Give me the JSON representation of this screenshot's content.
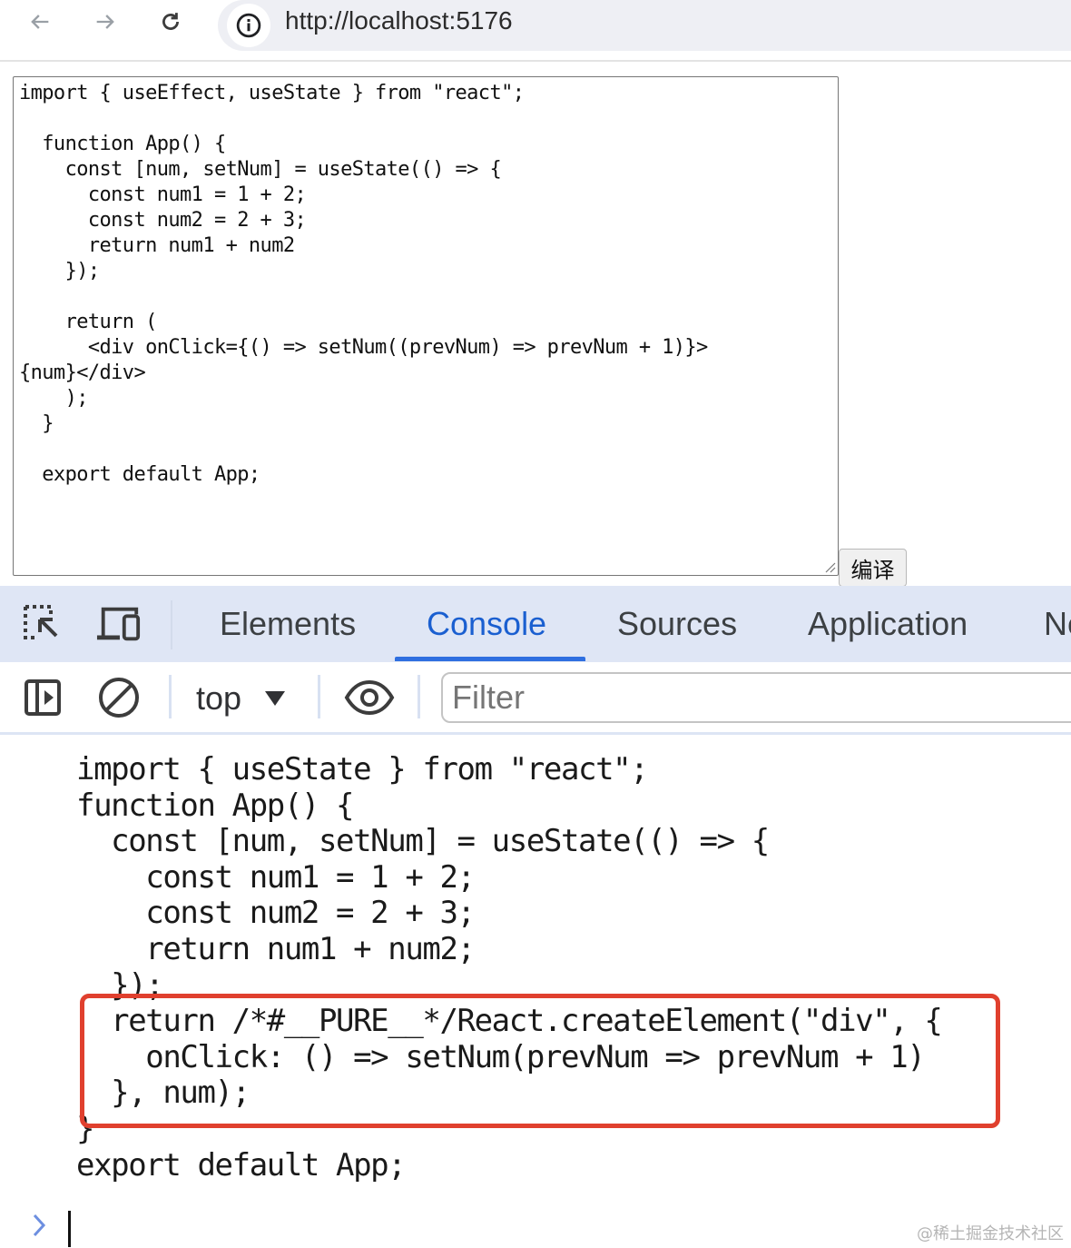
{
  "browser": {
    "url": "http://localhost:5176",
    "icons": [
      "back-arrow-icon",
      "forward-arrow-icon",
      "reload-icon",
      "info-icon"
    ]
  },
  "editor": {
    "code": "import { useEffect, useState } from \"react\";\n\n  function App() {\n    const [num, setNum] = useState(() => {\n      const num1 = 1 + 2;\n      const num2 = 2 + 3;\n      return num1 + num2\n    });\n\n    return (\n      <div onClick={() => setNum((prevNum) => prevNum + 1)}>\n{num}</div>\n    );\n  }\n\n  export default App;",
    "compile_button_label": "编译"
  },
  "devtools": {
    "tabs": [
      {
        "label": "Elements",
        "active": false
      },
      {
        "label": "Console",
        "active": true
      },
      {
        "label": "Sources",
        "active": false
      },
      {
        "label": "Application",
        "active": false
      },
      {
        "label": "Ne",
        "active": false
      }
    ],
    "icons": [
      "inspect-element-icon",
      "device-toolbar-icon"
    ],
    "accent_color": "#1a5fd0"
  },
  "console_toolbar": {
    "context": "top",
    "filter_placeholder": "Filter",
    "icons": [
      "sidebar-toggle-icon",
      "clear-console-icon",
      "live-expression-eye-icon"
    ]
  },
  "console": {
    "output": "import { useState } from \"react\";\nfunction App() {\n  const [num, setNum] = useState(() => {\n    const num1 = 1 + 2;\n    const num2 = 2 + 3;\n    return num1 + num2;\n  });\n  return /*#__PURE__*/React.createElement(\"div\", {\n    onClick: () => setNum(prevNum => prevNum + 1)\n  }, num);\n}\nexport default App;",
    "highlight_color": "#e0402e"
  },
  "watermark": "@稀土掘金技术社区"
}
